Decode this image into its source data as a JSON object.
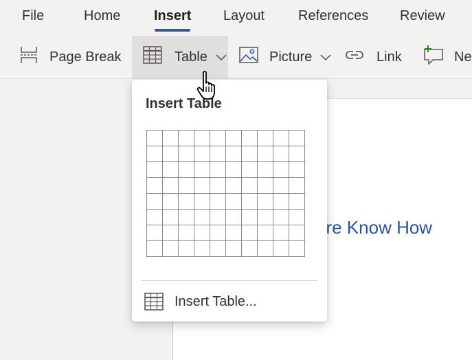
{
  "tabs": [
    {
      "label": "File"
    },
    {
      "label": "Home"
    },
    {
      "label": "Insert",
      "active": true
    },
    {
      "label": "Layout"
    },
    {
      "label": "References"
    },
    {
      "label": "Review"
    }
  ],
  "ribbon": {
    "page_break": "Page Break",
    "table": "Table",
    "picture": "Picture",
    "link": "Link",
    "new_comment": "Ne"
  },
  "document": {
    "heading_fragment": "are Know How"
  },
  "insert_table_menu": {
    "title": "Insert Table",
    "grid": {
      "columns": 10,
      "rows": 8
    },
    "item_label": "Insert Table..."
  },
  "colors": {
    "accent": "#2b579a",
    "heading": "#2f5496",
    "comment_plus": "#107c10"
  },
  "icons": [
    "page-break-icon",
    "table-icon",
    "chevron-down-icon",
    "picture-icon",
    "link-icon",
    "new-comment-icon",
    "hand-cursor-icon"
  ]
}
